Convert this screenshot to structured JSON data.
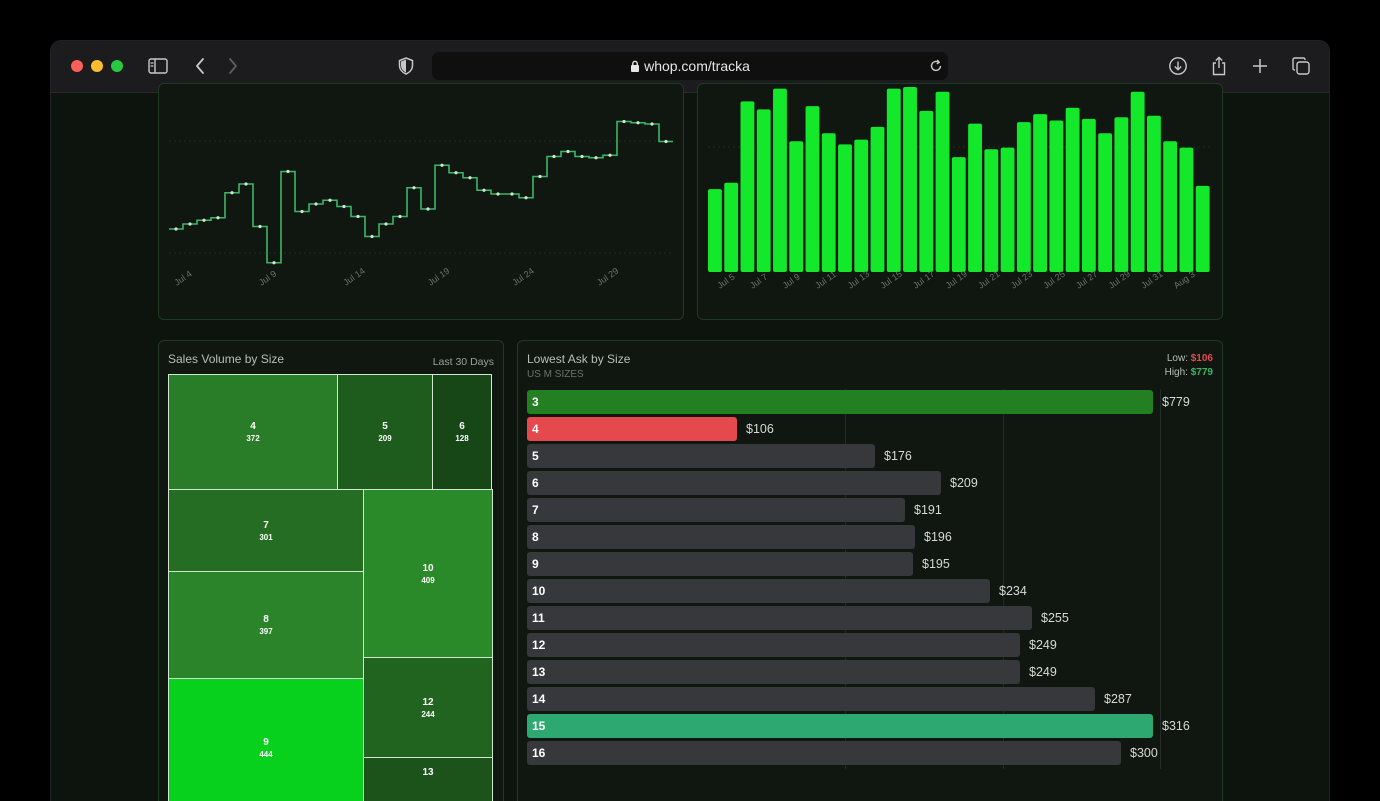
{
  "browser": {
    "url": "whop.com/tracka",
    "icons": [
      "sidebar-icon",
      "back-icon",
      "forward-icon",
      "shield-icon",
      "lock-icon",
      "reload-icon",
      "download-icon",
      "share-icon",
      "new-tab-icon",
      "tabs-icon"
    ]
  },
  "price_chart": {
    "x_ticks": [
      "Jul 4",
      "Jul 9",
      "Jul 14",
      "Jul 19",
      "Jul 24",
      "Jul 29"
    ],
    "values": [
      196,
      200,
      203,
      205,
      225,
      232,
      198,
      169,
      242,
      210,
      216,
      219,
      214,
      206,
      190,
      200,
      206,
      229,
      212,
      247,
      241,
      237,
      227,
      224,
      224,
      221,
      238,
      254,
      258,
      254,
      253,
      255,
      282,
      281,
      280,
      266
    ],
    "color": "#3fb36a"
  },
  "sales_chart": {
    "x_ticks": [
      "Jul 5",
      "Jul 7",
      "Jul 9",
      "Jul 11",
      "Jul 13",
      "Jul 15",
      "Jul 17",
      "Jul 19",
      "Jul 21",
      "Jul 23",
      "Jul 25",
      "Jul 27",
      "Jul 29",
      "Jul 31",
      "Aug 3"
    ],
    "values": [
      52,
      56,
      107,
      102,
      115,
      82,
      104,
      87,
      80,
      83,
      91,
      115,
      116,
      101,
      113,
      72,
      93,
      77,
      78,
      94,
      99,
      95,
      103,
      96,
      87,
      97,
      113,
      98,
      82,
      78,
      54
    ],
    "color": "#14e82a"
  },
  "volume_by_size": {
    "title": "Sales Volume by Size",
    "period": "Last 30 Days",
    "cells": [
      {
        "size": "4",
        "volume": "372",
        "color": "#2a7d28"
      },
      {
        "size": "5",
        "volume": "209",
        "color": "#1e5c1e"
      },
      {
        "size": "6",
        "volume": "128",
        "color": "#174617"
      },
      {
        "size": "7",
        "volume": "301",
        "color": "#246d22"
      },
      {
        "size": "10",
        "volume": "409",
        "color": "#2a8a29"
      },
      {
        "size": "8",
        "volume": "397",
        "color": "#2b832a"
      },
      {
        "size": "12",
        "volume": "244",
        "color": "#206420"
      },
      {
        "size": "9",
        "volume": "444",
        "color": "#08d11e"
      },
      {
        "size": "13",
        "volume": "",
        "color": "#1b531b"
      }
    ]
  },
  "lowest_ask": {
    "title": "Lowest Ask by Size",
    "subtitle": "US M SIZES",
    "low_label": "Low:",
    "low_value": "$106",
    "high_label": "High:",
    "high_value": "$779",
    "colors": {
      "high": "#237f22",
      "low": "#e5484d",
      "best": "#2ea871",
      "default": "#36383c"
    },
    "rows": [
      {
        "size": "3",
        "price": "$779",
        "value": 779,
        "kind": "high"
      },
      {
        "size": "4",
        "price": "$106",
        "value": 106,
        "kind": "low"
      },
      {
        "size": "5",
        "price": "$176",
        "value": 176,
        "kind": "default"
      },
      {
        "size": "6",
        "price": "$209",
        "value": 209,
        "kind": "default"
      },
      {
        "size": "7",
        "price": "$191",
        "value": 191,
        "kind": "default"
      },
      {
        "size": "8",
        "price": "$196",
        "value": 196,
        "kind": "default"
      },
      {
        "size": "9",
        "price": "$195",
        "value": 195,
        "kind": "default"
      },
      {
        "size": "10",
        "price": "$234",
        "value": 234,
        "kind": "default"
      },
      {
        "size": "11",
        "price": "$255",
        "value": 255,
        "kind": "default"
      },
      {
        "size": "12",
        "price": "$249",
        "value": 249,
        "kind": "default"
      },
      {
        "size": "13",
        "price": "$249",
        "value": 249,
        "kind": "default"
      },
      {
        "size": "14",
        "price": "$287",
        "value": 287,
        "kind": "default"
      },
      {
        "size": "15",
        "price": "$316",
        "value": 316,
        "kind": "best"
      },
      {
        "size": "16",
        "price": "$300",
        "value": 300,
        "kind": "default"
      }
    ]
  }
}
